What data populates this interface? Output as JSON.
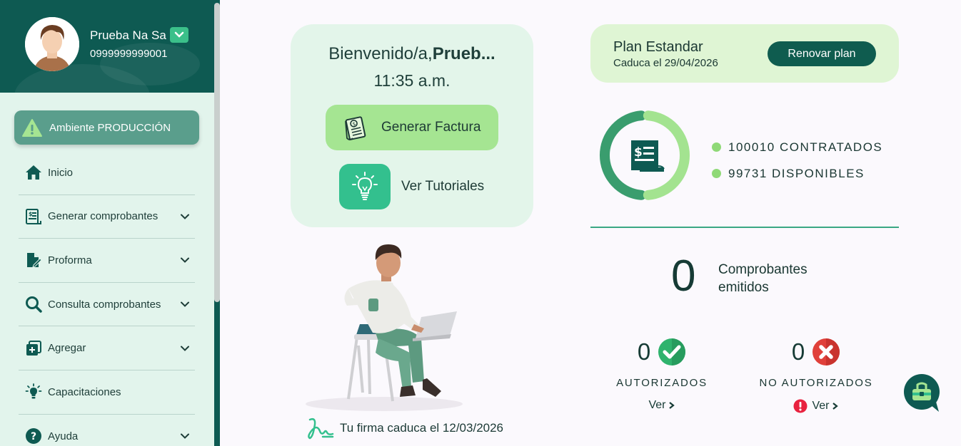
{
  "user": {
    "name": "Prueba Na Sa",
    "id": "0999999999001"
  },
  "environment": {
    "label": "Ambiente PRODUCCIÓN"
  },
  "menu": [
    {
      "label": "Inicio",
      "icon": "home-icon",
      "has_submenu": false
    },
    {
      "label": "Generar comprobantes",
      "icon": "invoice-icon",
      "has_submenu": true
    },
    {
      "label": "Proforma",
      "icon": "document-edit-icon",
      "has_submenu": true
    },
    {
      "label": "Consulta comprobantes",
      "icon": "search-icon",
      "has_submenu": true
    },
    {
      "label": "Agregar",
      "icon": "add-icon",
      "has_submenu": true
    },
    {
      "label": "Capacitaciones",
      "icon": "lightbulb-icon",
      "has_submenu": false
    },
    {
      "label": "Ayuda",
      "icon": "help-icon",
      "has_submenu": true
    }
  ],
  "welcome": {
    "greeting": "Bienvenido/a,",
    "name": "Prueb...",
    "time": "11:35 a.m.",
    "generate_label": "Generar Factura",
    "tutorials_label": "Ver Tutoriales"
  },
  "signature": {
    "text": "Tu firma caduca el 12/03/2026"
  },
  "plan": {
    "name": "Plan Estandar",
    "expires": "Caduca el 29/04/2026",
    "renew_label": "Renovar plan"
  },
  "usage": {
    "contracted": 100010,
    "available": 99731,
    "contracted_label": "100010 CONTRATADOS",
    "available_label": "99731 DISPONIBLES"
  },
  "stats": {
    "total": "0",
    "total_label": "Comprobantes emitidos",
    "authorized": "0",
    "authorized_label": "AUTORIZADOS",
    "not_authorized": "0",
    "not_authorized_label": "NO AUTORIZADOS",
    "view_label": "Ver"
  },
  "colors": {
    "primary": "#0e5a52",
    "accent_green": "#a5e592",
    "teal": "#33c08e",
    "donut_dark": "#3a9d6e",
    "donut_light": "#a3e390",
    "success": "#2fb36d",
    "error": "#e0403a"
  }
}
